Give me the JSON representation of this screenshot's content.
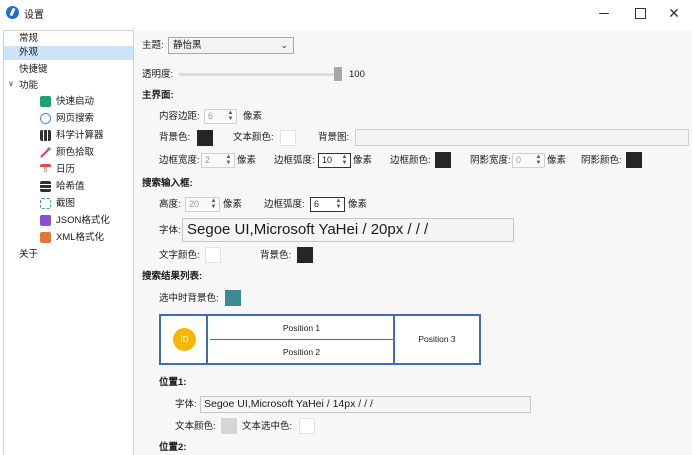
{
  "window": {
    "title": "设置",
    "close_glyph": "✕"
  },
  "sidebar": {
    "items": [
      {
        "label": "常规"
      },
      {
        "label": "外观",
        "selected": true
      },
      {
        "label": "快捷键"
      },
      {
        "label": "功能",
        "expander": "∨"
      },
      {
        "label": "快速启动",
        "icon": "quick-launch-icon",
        "color": "#1aa36b"
      },
      {
        "label": "网页搜索",
        "icon": "globe-icon",
        "color": "#3a8ee6"
      },
      {
        "label": "科学计算器",
        "icon": "calculator-icon",
        "color": "#2f2f2f"
      },
      {
        "label": "颜色拾取",
        "icon": "color-picker-icon",
        "color": "#d93a7e"
      },
      {
        "label": "日历",
        "icon": "calendar-icon",
        "color": "#e04747",
        "icon_text": "5"
      },
      {
        "label": "哈希值",
        "icon": "hash-grid-icon",
        "color": "#2f2f2f"
      },
      {
        "label": "截图",
        "icon": "screenshot-icon",
        "color": "#3fa7a0"
      },
      {
        "label": "JSON格式化",
        "icon": "json-icon",
        "color": "#8a4fd8"
      },
      {
        "label": "XML格式化",
        "icon": "xml-icon",
        "color": "#e3773a"
      },
      {
        "label": "关于"
      }
    ]
  },
  "appearance": {
    "theme_label": "主题:",
    "theme_value": "静怡黑",
    "opacity_label": "透明度:",
    "opacity_value": "100",
    "opacity_level": 1.0,
    "main_section": "主界面:",
    "padding_label": "内容边距:",
    "padding_value": "6",
    "px": "像素",
    "bg_color_label": "背景色:",
    "text_color_label": "文本颜色:",
    "bg_image_label": "背景图:",
    "border_width_label": "边框宽度:",
    "border_width_value": "2",
    "border_radius_label": "边框弧度:",
    "border_radius_value": "10",
    "border_color_label": "边框颜色:",
    "shadow_width_label": "阴影宽度:",
    "shadow_width_value": "0",
    "shadow_color_label": "阴影颜色:",
    "search_section": "搜索输入框:",
    "height_label": "高度:",
    "height_value": "20",
    "search_radius_label": "边框弧度:",
    "search_radius_value": "6",
    "font_label": "字体:",
    "font_value": "Segoe UI,Microsoft YaHei / 20px /  /  / ",
    "search_text_color_label": "文字颜色:",
    "search_bg_label": "背景色:",
    "result_section": "搜索结果列表:",
    "selected_bg_label": "选中时背景色:",
    "preview": {
      "id": "ID",
      "p1": "Position 1",
      "p2": "Position 2",
      "p3": "Position 3"
    },
    "pos1_section": "位置1:",
    "pos1_font_label": "字体:",
    "pos1_font_value": "Segoe UI,Microsoft YaHei / 14px /  /  / ",
    "pos1_text_color_label": "文本颜色:",
    "pos1_selected_label": "文本选中色:",
    "pos2_section": "位置2:"
  },
  "colors": {
    "accent_blue": "#3c6bc4",
    "sidebar_selected": "#cde3f7",
    "dark_swatch": "#252525",
    "teal_swatch": "#3b8a8f",
    "id_circle": "#f5b800"
  }
}
